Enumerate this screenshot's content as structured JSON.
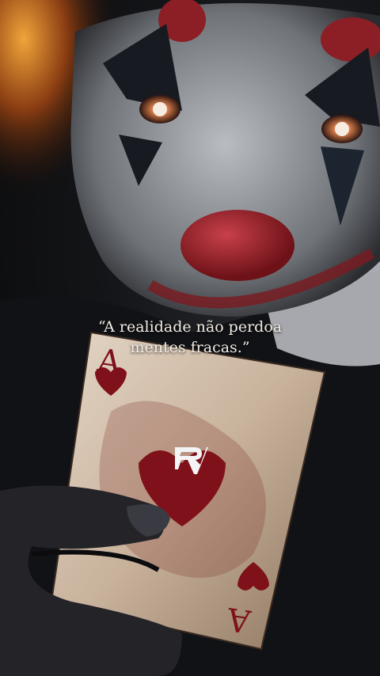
{
  "quote": {
    "line1": "“A realidade não perdoa",
    "line2": "mentes fracas.”"
  },
  "logo": {
    "icon": "rv-monogram-logo"
  },
  "scene": {
    "subject": "clown-face-with-playing-card",
    "card": {
      "rank": "A",
      "suit": "hearts"
    },
    "colors": {
      "background": "#0b0b0d",
      "face_paint": "#c9ccd0",
      "nose_red": "#a3232b",
      "fire_orange": "#d9822b",
      "card_paper": "#d9c7b4",
      "heart_red": "#7e111a",
      "text": "#f1ece4"
    }
  }
}
